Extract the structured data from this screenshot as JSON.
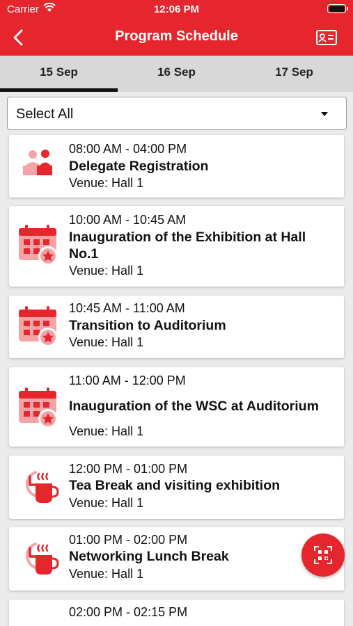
{
  "status": {
    "carrier": "Carrier",
    "time": "12:06 PM"
  },
  "header": {
    "title": "Program Schedule"
  },
  "tabs": [
    {
      "label": "15 Sep",
      "active": true
    },
    {
      "label": "16 Sep",
      "active": false
    },
    {
      "label": "17 Sep",
      "active": false
    }
  ],
  "filter": {
    "selected": "Select All"
  },
  "sessions": [
    {
      "time": "08:00 AM - 04:00 PM",
      "title": "Delegate Registration",
      "venue": "Venue: Hall 1",
      "icon": "registration-icon"
    },
    {
      "time": "10:00 AM - 10:45 AM",
      "title": "Inauguration of the Exhibition at Hall No.1",
      "venue": "Venue: Hall 1",
      "icon": "calendar-star-icon"
    },
    {
      "time": "10:45 AM - 11:00 AM",
      "title": "Transition to Auditorium",
      "venue": "Venue: Hall 1",
      "icon": "calendar-star-icon"
    },
    {
      "time": "11:00 AM - 12:00 PM",
      "title": "Inauguration of the WSC at Auditorium",
      "venue": "Venue: Hall 1",
      "icon": "calendar-star-icon"
    },
    {
      "time": "12:00 PM - 01:00 PM",
      "title": "Tea Break and visiting exhibition",
      "venue": "Venue: Hall 1",
      "icon": "tea-break-icon"
    },
    {
      "time": "01:00 PM - 02:00 PM",
      "title": "Networking Lunch Break",
      "venue": "Venue: Hall 1",
      "icon": "tea-break-icon"
    },
    {
      "time": "02:00 PM - 02:15 PM",
      "title": "",
      "venue": "",
      "icon": ""
    }
  ],
  "colors": {
    "accent": "#e5262d",
    "icon_light": "#f5a3a6"
  }
}
